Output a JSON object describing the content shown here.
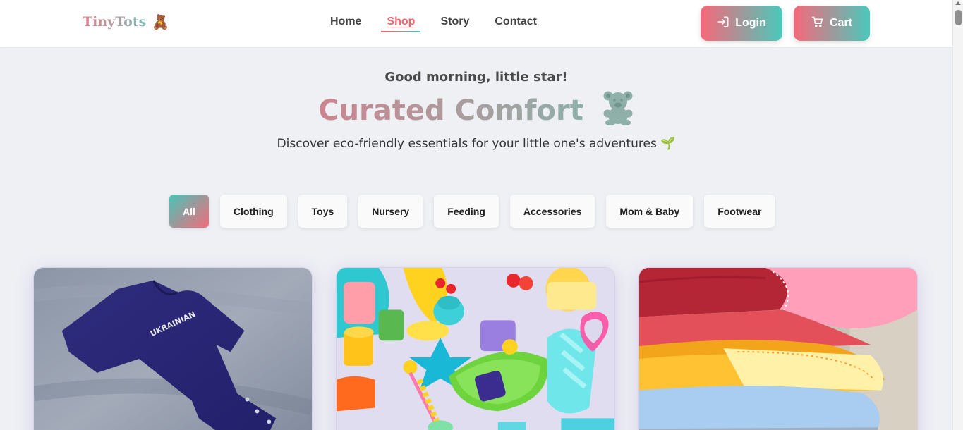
{
  "header": {
    "logo_text": "TinyTots",
    "logo_emoji": "🧸",
    "nav": [
      {
        "label": "Home",
        "active": false
      },
      {
        "label": "Shop",
        "active": true
      },
      {
        "label": "Story",
        "active": false
      },
      {
        "label": "Contact",
        "active": false
      }
    ],
    "login_label": "Login",
    "cart_label": "Cart"
  },
  "hero": {
    "greeting": "Good morning, little star!",
    "title": "Curated Comfort",
    "tagline": "Discover eco-friendly essentials for your little one's adventures 🌱"
  },
  "filters": {
    "items": [
      "All",
      "Clothing",
      "Toys",
      "Nursery",
      "Feeding",
      "Accessories",
      "Mom & Baby",
      "Footwear"
    ],
    "selected": "All"
  },
  "products": [
    {
      "image": "navy-baby-bodysuit",
      "print": "UKRAINIAN"
    },
    {
      "image": "colorful-baby-toys"
    },
    {
      "image": "folded-colorful-blankets"
    }
  ],
  "colors": {
    "accent_pink": "#f7687a",
    "accent_teal": "#49c9bb",
    "background": "#eef0f4"
  }
}
